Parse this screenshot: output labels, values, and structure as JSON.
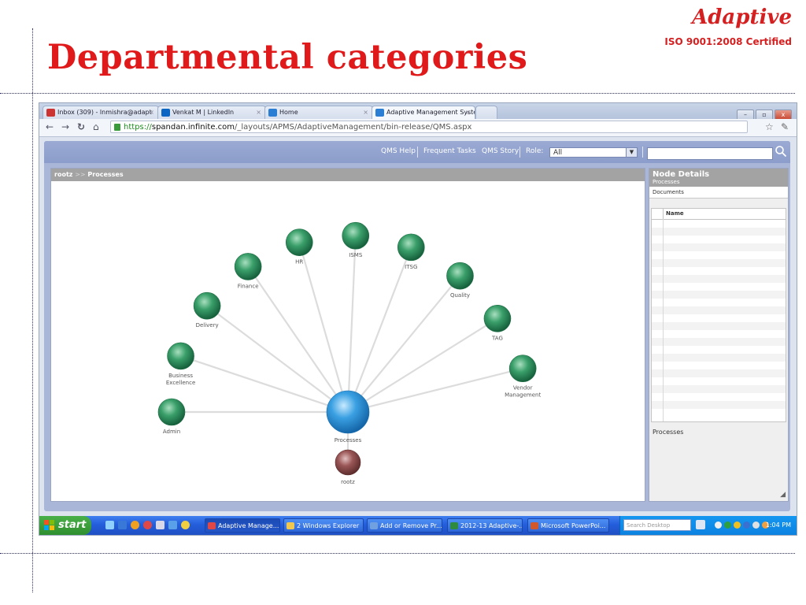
{
  "slide": {
    "title": "Departmental categories",
    "brand_name": "Adaptive",
    "brand_cert": "ISO 9001:2008 Certified"
  },
  "browser": {
    "tabs": [
      {
        "label": "Inbox (309) - lnmishra@adapt",
        "icon_color": "#cc3333"
      },
      {
        "label": "Venkat M | LinkedIn",
        "icon_color": "#0a66c2"
      },
      {
        "label": "Home",
        "icon_color": "#2a7fd4"
      },
      {
        "label": "Adaptive Management System",
        "icon_color": "#2a7fd4"
      }
    ],
    "url_scheme": "https://",
    "url_host": "spandan.infinite.com",
    "url_path": "/_layouts/APMS/AdaptiveManagement/bin-release/QMS.aspx",
    "window_buttons": [
      "–",
      "▫",
      "x"
    ]
  },
  "app": {
    "nav_links": [
      "QMS Help",
      "Frequent Tasks",
      "QMS Story"
    ],
    "role_label": "Role:",
    "role_value": "All",
    "breadcrumb_root": "rootz",
    "breadcrumb_sep": ">>",
    "breadcrumb_current": "Processes",
    "graph": {
      "center": "Processes",
      "parent": "rootz",
      "children": [
        "Admin",
        "Business Excellence",
        "Delivery",
        "Finance",
        "HR",
        "ISMS",
        "ITSG",
        "Quality",
        "TAG",
        "Vendor Management"
      ]
    },
    "details": {
      "title": "Node Details",
      "subtitle": "Processes",
      "tab": "Documents",
      "column": "Name",
      "footer": "Processes"
    }
  },
  "taskbar": {
    "start_label": "start",
    "tasks": [
      "Adaptive Manage...",
      "2 Windows Explorer",
      "Add or Remove Pr...",
      "2012-13 Adaptive-...",
      "Microsoft PowerPoi..."
    ],
    "search_placeholder": "Search Desktop",
    "clock": "1:04 PM"
  },
  "colors": {
    "slide_title": "#e01a1a",
    "child_node": "#2e8b57",
    "center_node": "#2b8fd6",
    "parent_node": "#8a4a4a",
    "taskbar": "#245edb"
  }
}
